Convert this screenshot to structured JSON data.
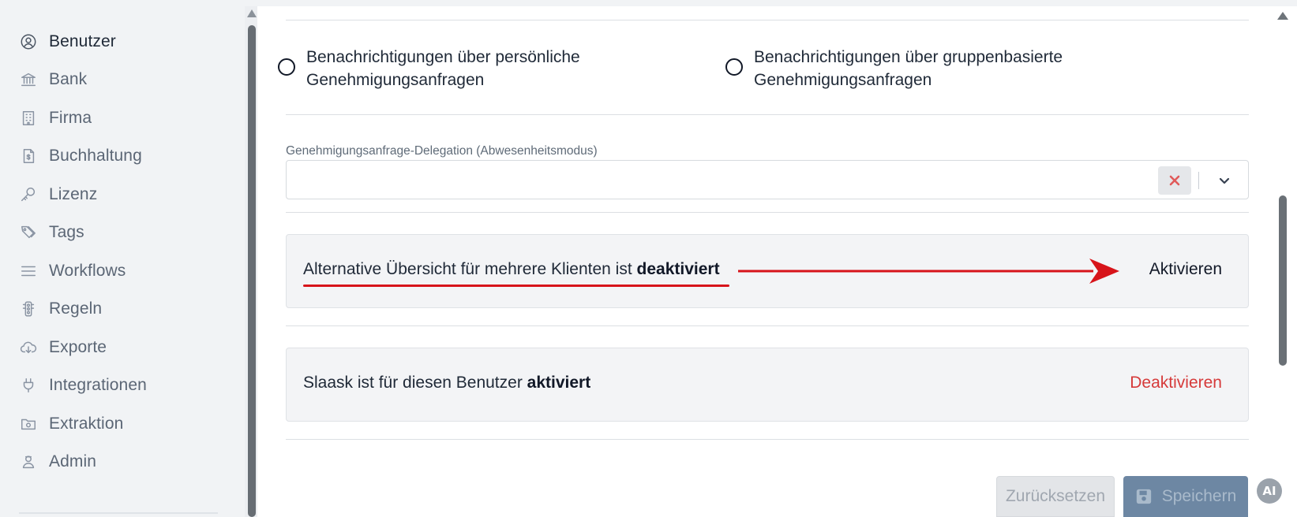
{
  "sidebar": {
    "items": [
      {
        "label": "Benutzer",
        "icon": "user-circle-icon"
      },
      {
        "label": "Bank",
        "icon": "bank-icon"
      },
      {
        "label": "Firma",
        "icon": "building-icon"
      },
      {
        "label": "Buchhaltung",
        "icon": "invoice-icon"
      },
      {
        "label": "Lizenz",
        "icon": "key-icon"
      },
      {
        "label": "Tags",
        "icon": "tags-icon"
      },
      {
        "label": "Workflows",
        "icon": "list-lines-icon"
      },
      {
        "label": "Regeln",
        "icon": "traffic-light-icon"
      },
      {
        "label": "Exporte",
        "icon": "cloud-download-icon"
      },
      {
        "label": "Integrationen",
        "icon": "plug-icon"
      },
      {
        "label": "Extraktion",
        "icon": "folder-gear-icon"
      },
      {
        "label": "Admin",
        "icon": "admin-person-icon"
      }
    ],
    "active_item": "Benutzer"
  },
  "notifications": {
    "option_personal": "Benachrichtigungen über persönliche Genehmigungsanfragen",
    "option_group": "Benachrichtigungen über gruppenbasierte Genehmigungsanfragen"
  },
  "delegation": {
    "label": "Genehmigungsanfrage-Delegation (Abwesenheitsmodus)",
    "value": ""
  },
  "multi_client_panel": {
    "text_prefix": "Alternative Übersicht für mehrere Klienten ist ",
    "status": "deaktiviert",
    "action_label": "Aktivieren",
    "annotation_color": "#d7141a"
  },
  "slaask_panel": {
    "text_prefix": "Slaask ist für diesen Benutzer ",
    "status": "aktiviert",
    "action_label": "Deaktivieren",
    "action_color": "#d63a3a"
  },
  "actions": {
    "reset_label": "Zurücksetzen",
    "save_label": "Speichern"
  },
  "ai_badge": "AI"
}
